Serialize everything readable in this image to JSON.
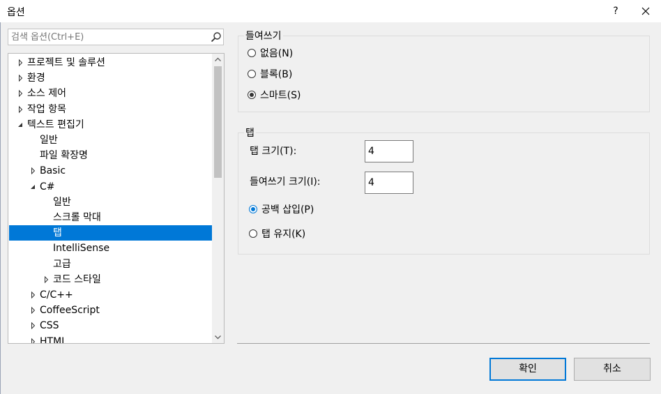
{
  "window": {
    "title": "옵션",
    "help_label": "?"
  },
  "search": {
    "placeholder": "검색 옵션(Ctrl+E)"
  },
  "tree": {
    "items": [
      {
        "label": "프로젝트 및 솔루션",
        "level": 0,
        "expander": "collapsed"
      },
      {
        "label": "환경",
        "level": 0,
        "expander": "collapsed"
      },
      {
        "label": "소스 제어",
        "level": 0,
        "expander": "collapsed"
      },
      {
        "label": "작업 항목",
        "level": 0,
        "expander": "collapsed"
      },
      {
        "label": "텍스트 편집기",
        "level": 0,
        "expander": "expanded"
      },
      {
        "label": "일반",
        "level": 1,
        "expander": "none"
      },
      {
        "label": "파일 확장명",
        "level": 1,
        "expander": "none"
      },
      {
        "label": "Basic",
        "level": 1,
        "expander": "collapsed"
      },
      {
        "label": "C#",
        "level": 1,
        "expander": "expanded"
      },
      {
        "label": "일반",
        "level": 2,
        "expander": "none"
      },
      {
        "label": "스크롤 막대",
        "level": 2,
        "expander": "none"
      },
      {
        "label": "탭",
        "level": 2,
        "expander": "none",
        "selected": true
      },
      {
        "label": "IntelliSense",
        "level": 2,
        "expander": "none"
      },
      {
        "label": "고급",
        "level": 2,
        "expander": "none"
      },
      {
        "label": "코드 스타일",
        "level": 2,
        "expander": "collapsed"
      },
      {
        "label": "C/C++",
        "level": 1,
        "expander": "collapsed"
      },
      {
        "label": "CoffeeScript",
        "level": 1,
        "expander": "collapsed"
      },
      {
        "label": "CSS",
        "level": 1,
        "expander": "collapsed"
      },
      {
        "label": "HTML",
        "level": 1,
        "expander": "collapsed"
      }
    ]
  },
  "indent_group": {
    "title": "들여쓰기",
    "options": [
      {
        "label": "없음(N)",
        "checked": false
      },
      {
        "label": "블록(B)",
        "checked": false
      },
      {
        "label": "스마트(S)",
        "checked": true
      }
    ]
  },
  "tab_group": {
    "title": "탭",
    "tab_size_label": "탭 크기(T):",
    "tab_size_value": "4",
    "indent_size_label": "들여쓰기 크기(I):",
    "indent_size_value": "4",
    "options": [
      {
        "label": "공백 삽입(P)",
        "checked": true
      },
      {
        "label": "탭 유지(K)",
        "checked": false
      }
    ]
  },
  "buttons": {
    "ok": "확인",
    "cancel": "취소"
  },
  "colors": {
    "selection": "#0078d7",
    "background": "#f0f0f0"
  }
}
